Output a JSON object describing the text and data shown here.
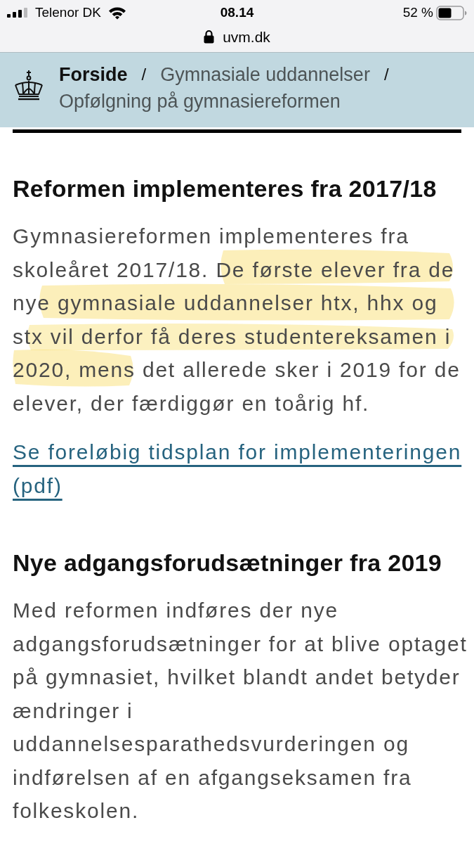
{
  "status_bar": {
    "carrier": "Telenor DK",
    "time": "08.14",
    "battery": "52 %"
  },
  "address_bar": {
    "url": "uvm.dk"
  },
  "breadcrumb": [
    {
      "label": "Forside",
      "kind": "home",
      "separator": "/"
    },
    {
      "label": "Gymnasiale uddannelser",
      "kind": "link",
      "separator": "/"
    },
    {
      "label": "Opfølgning på gymnasiereformen",
      "kind": "current"
    }
  ],
  "sections": [
    {
      "heading": "Reformen implementeres fra 2017/18",
      "paragraph": "Gymnasiereformen implementeres fra skoleåret 2017/18. De første elever fra de nye gymnasiale uddannelser htx, hhx og stx vil derfor få deres studentereksamen i 2020, mens det allerede sker i 2019 for de elever, der færdiggør en toårig hf.",
      "highlighted": true,
      "link": "Se foreløbig tidsplan for implementeringen (pdf)"
    },
    {
      "heading": "Nye adgangsforudsætninger fra 2019",
      "paragraph": "Med reformen indføres der nye adgangsforudsætninger for at blive optaget på gymnasiet, hvilket blandt andet betyder ændringer i uddannelsesparathedsvurderingen og indførelsen af en afgangseksamen fra folkeskolen.",
      "highlighted": false
    }
  ]
}
